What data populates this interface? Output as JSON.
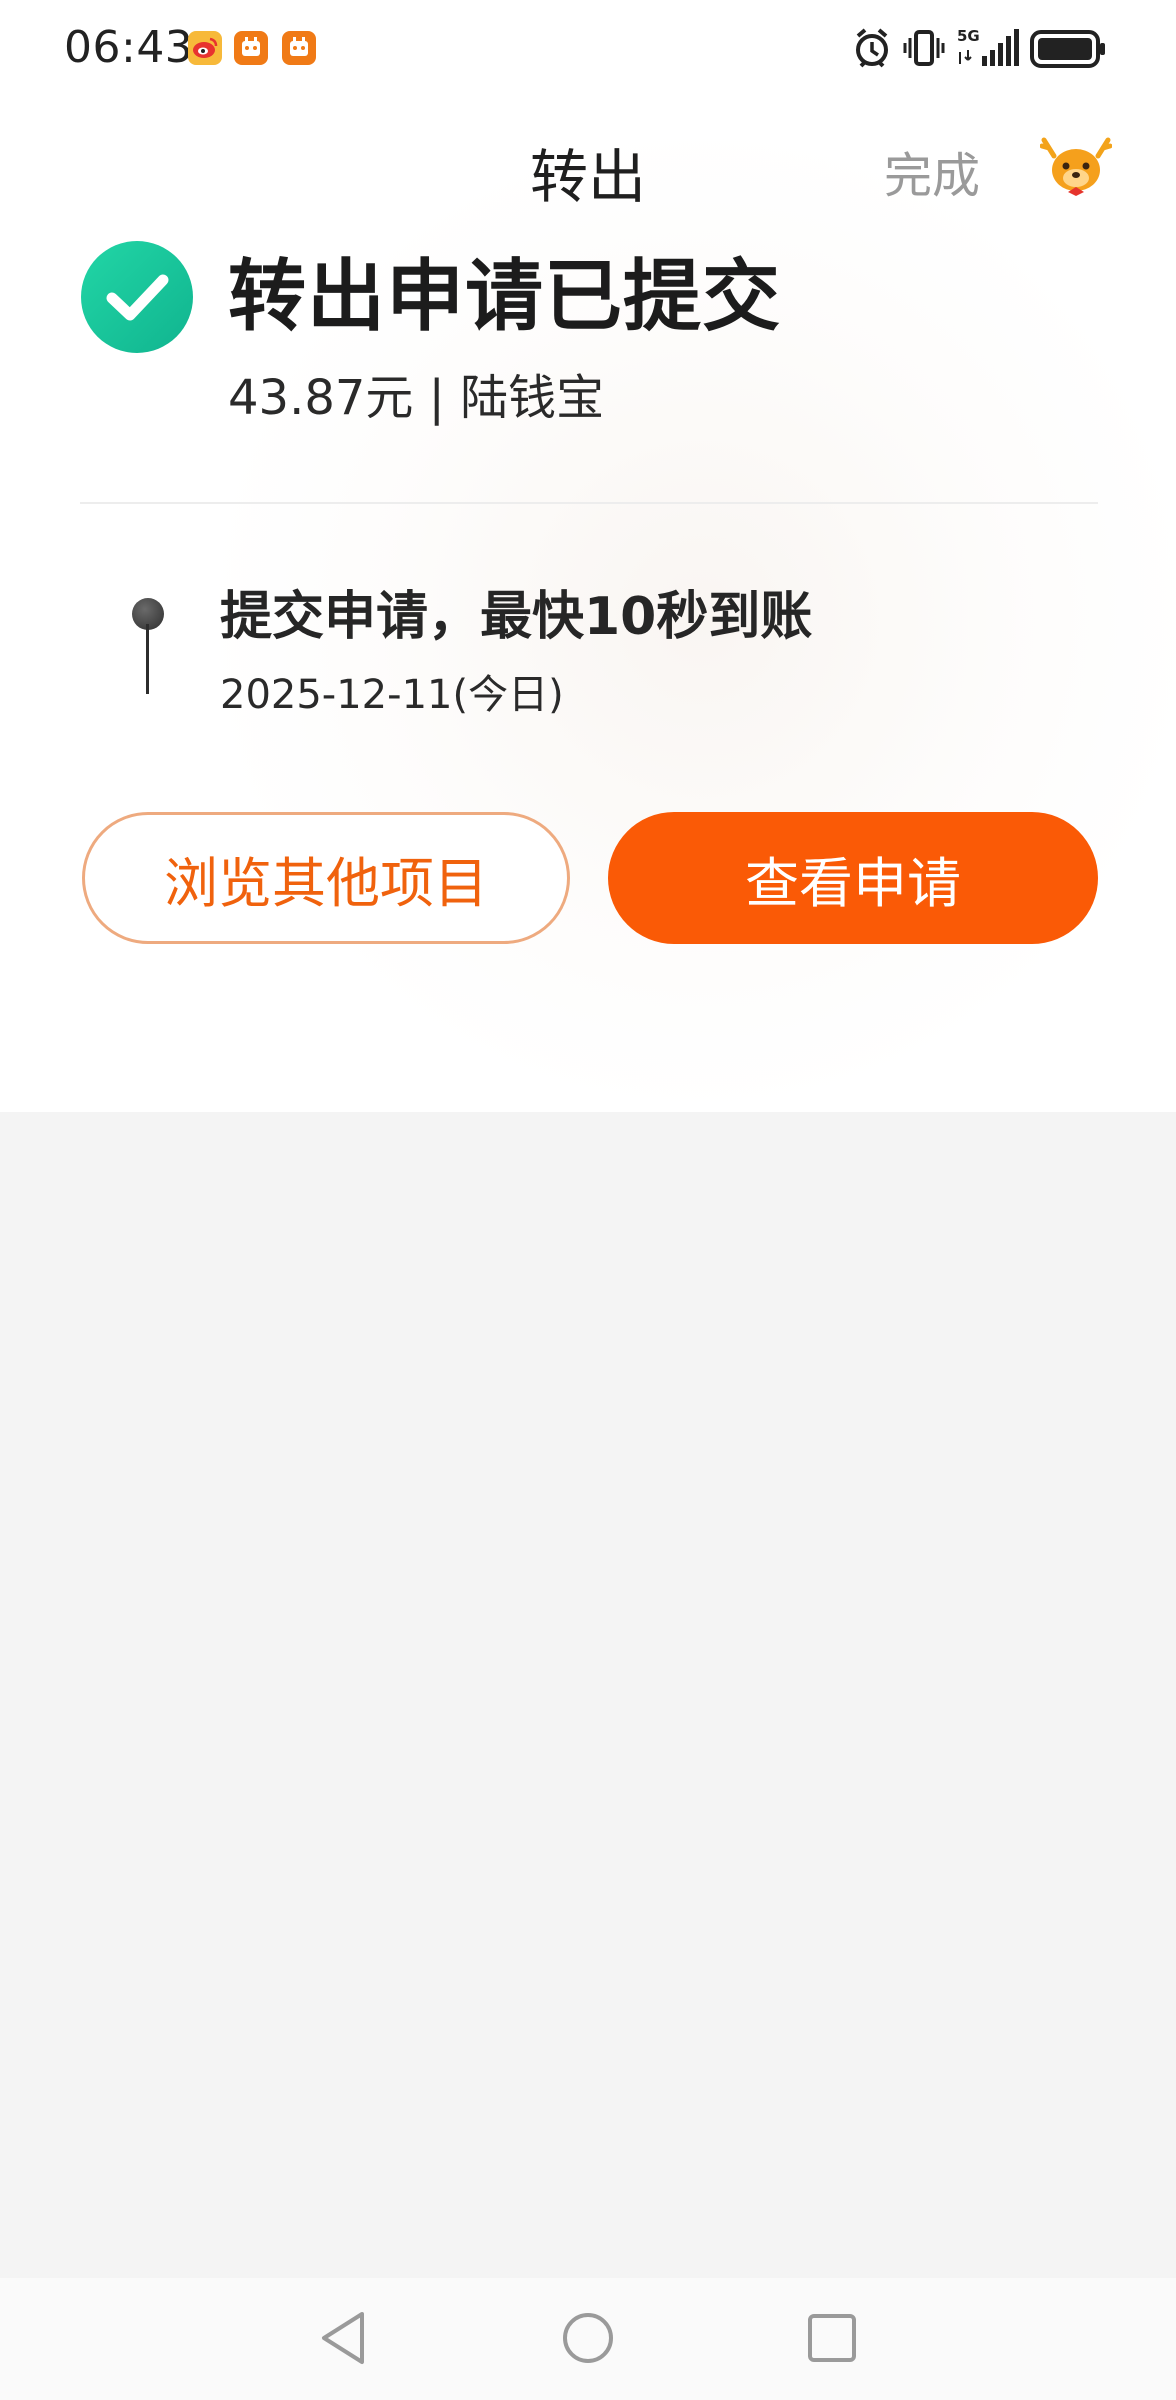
{
  "status_bar": {
    "time": "06:43",
    "notification_icons": [
      "weibo-icon",
      "app-notification-icon",
      "app-notification-icon"
    ],
    "system_icons": [
      "alarm-icon",
      "vibrate-icon",
      "5g-signal-icon",
      "battery-icon"
    ]
  },
  "header": {
    "title": "转出",
    "done_label": "完成",
    "mascot_icon": "deer-mascot-icon"
  },
  "result": {
    "title": "转出申请已提交",
    "amount_line": "43.87元 | 陆钱宝",
    "icon": "success-check-icon"
  },
  "timeline": [
    {
      "text": "提交申请，最快10秒到账",
      "date": "2025-12-11(今日)"
    }
  ],
  "actions": {
    "browse_label": "浏览其他项目",
    "view_label": "查看申请"
  },
  "colors": {
    "accent": "#fa5a06",
    "success": "#14c39a",
    "secondary_text": "#9a9a9a"
  },
  "system_nav": [
    "back-icon",
    "home-icon",
    "recents-icon"
  ]
}
